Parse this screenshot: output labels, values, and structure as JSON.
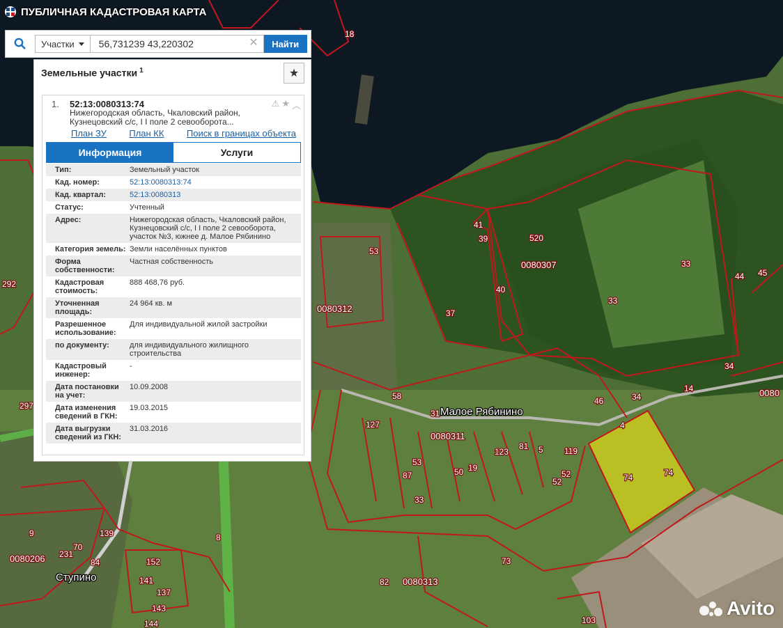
{
  "app": {
    "title": "ПУБЛИЧНАЯ КАДАСТРОВАЯ КАРТА"
  },
  "search": {
    "type_label": "Участки",
    "value": "56,731239 43,220302",
    "button_label": "Найти"
  },
  "panel": {
    "title": "Земельные участки",
    "count": "1",
    "item": {
      "index": "1.",
      "cadastral_number": "52:13:0080313:74",
      "address_short": "Нижегородская область, Чкаловский район, Кузнецовский с/с, I I поле 2 севооборота...",
      "links": [
        "План ЗУ →",
        "План КК →",
        "Поиск в границах объекта →"
      ]
    },
    "tabs": [
      "Информация",
      "Услуги"
    ],
    "rows": [
      {
        "k": "Тип:",
        "v": "Земельный участок"
      },
      {
        "k": "Кад. номер:",
        "v": "52:13:0080313:74",
        "link": true
      },
      {
        "k": "Кад. квартал:",
        "v": "52:13:0080313",
        "link": true
      },
      {
        "k": "Статус:",
        "v": "Учтенный"
      },
      {
        "k": "Адрес:",
        "v": "Нижегородская область, Чкаловский район, Кузнецовский с/с, I I поле 2 севооборота, участок №3, южнее д. Малое Рябинино"
      },
      {
        "k": "Категория земель:",
        "v": "Земли населённых пунктов"
      },
      {
        "k": "Форма собственности:",
        "v": "Частная собственность"
      },
      {
        "k": "Кадастровая стоимость:",
        "v": "888 468,76 руб."
      },
      {
        "k": "Уточненная площадь:",
        "v": "24 964 кв. м"
      },
      {
        "k": "Разрешенное использование:",
        "v": "Для индивидуальной жилой застройки"
      },
      {
        "k": "по документу:",
        "v": "для индивидуального жилищного строительства"
      },
      {
        "k": "Кадастровый инженер:",
        "v": "-"
      },
      {
        "k": "Дата постановки на учет:",
        "v": "10.09.2008"
      },
      {
        "k": "Дата изменения сведений в ГКН:",
        "v": "19.03.2015"
      },
      {
        "k": "Дата выгрузки сведений из ГКН:",
        "v": "31.03.2016"
      }
    ]
  },
  "map": {
    "places": [
      "Малое Рябинино",
      "Ступино"
    ],
    "quarters": [
      "0080307",
      "0080312",
      "0080311",
      "0080313",
      "0080206",
      "0080"
    ],
    "parcel_labels": [
      "18",
      "41",
      "39",
      "520",
      "53",
      "40",
      "33",
      "33",
      "44",
      "45",
      "37",
      "34",
      "14",
      "46",
      "34",
      "4",
      "74",
      "74",
      "127",
      "58",
      "31",
      "5",
      "119",
      "52",
      "52",
      "19",
      "50",
      "87",
      "53",
      "33",
      "123",
      "81",
      "73",
      "82",
      "297",
      "292",
      "9",
      "8",
      "231",
      "70",
      "139",
      "84",
      "152",
      "141",
      "137",
      "143",
      "144",
      "103"
    ],
    "colors": {
      "boundary": "#c0181c",
      "selected_fill": "#d9d41c",
      "water": "#0f1a24",
      "forest": "#2f5a22",
      "field": "#6d8b43"
    }
  },
  "watermark": "Avito"
}
